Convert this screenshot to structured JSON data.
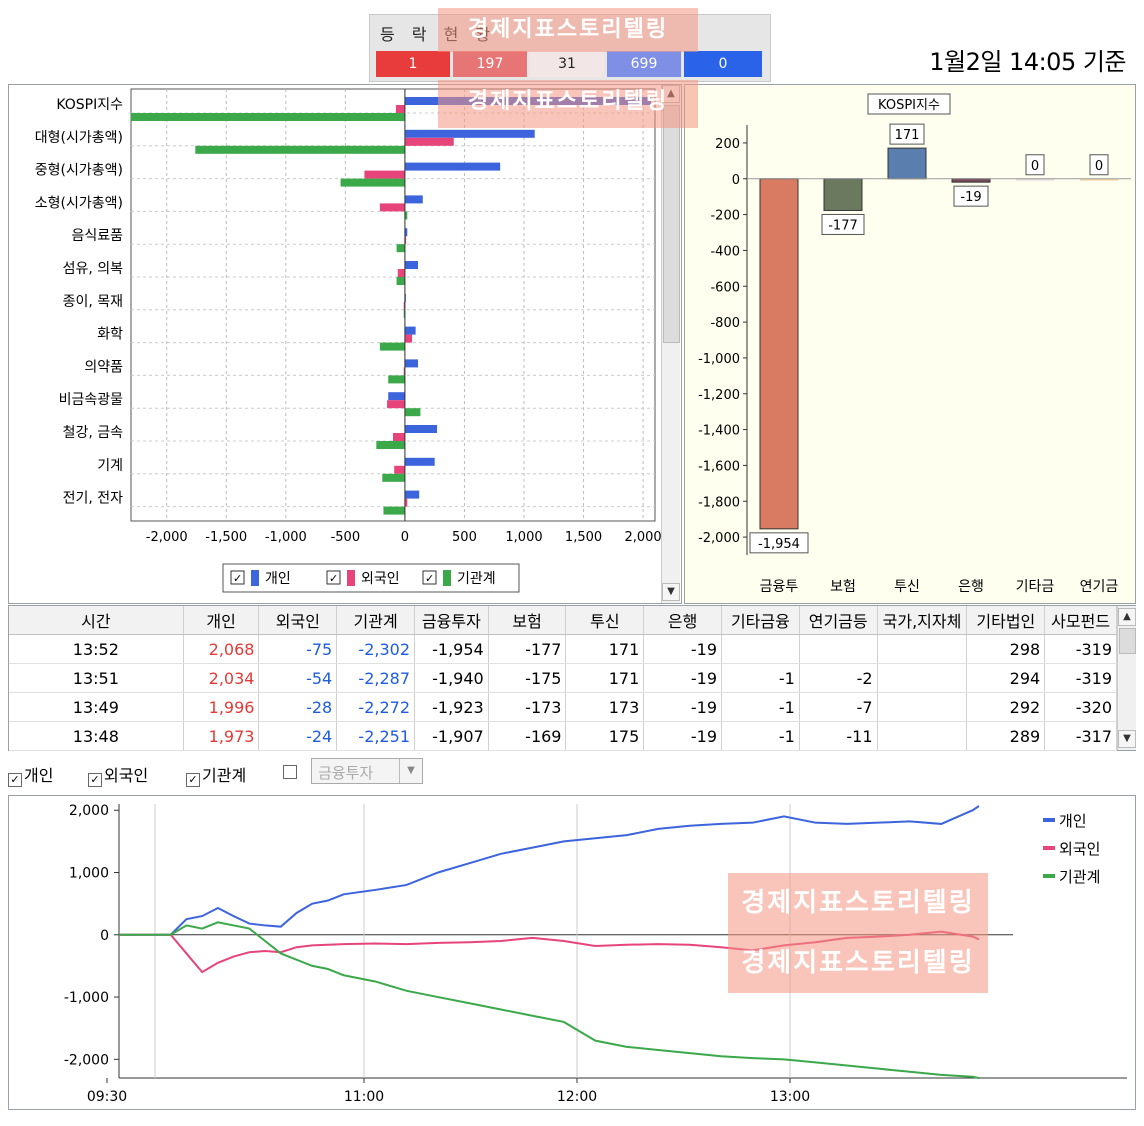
{
  "header": {
    "adv_title": "등 락 현 황",
    "adv_cells": [
      {
        "value": "1",
        "color": "#e83c3c"
      },
      {
        "value": "197",
        "color": "#e87575"
      },
      {
        "value": "31",
        "color": "#f3e6e6"
      },
      {
        "value": "699",
        "color": "#7f8fe6"
      },
      {
        "value": "0",
        "color": "#2a62e8"
      }
    ],
    "as_of": "1월2일 14:05 기준"
  },
  "watermark": "경제지표스토리텔링",
  "colors": {
    "individual": "#3c64dc",
    "foreign": "#e6447a",
    "institution": "#3ba84a"
  },
  "sector_chart": {
    "type": "bar",
    "categories": [
      "KOSPI지수",
      "대형(시가총액)",
      "중형(시가총액)",
      "소형(시가총액)",
      "음식료품",
      "섬유, 의복",
      "종이, 목재",
      "화학",
      "의약품",
      "비금속광물",
      "철강, 금속",
      "기계",
      "전기, 전자"
    ],
    "x_ticks": [
      "-2,000",
      "-1,500",
      "-1,000",
      "-500",
      "0",
      "500",
      "1,000",
      "1,500",
      "2,000"
    ],
    "xlim": [
      -2300,
      2100
    ],
    "series": [
      {
        "name": "개인",
        "values": [
          2068,
          1090,
          800,
          150,
          20,
          110,
          5,
          90,
          110,
          -140,
          270,
          250,
          120
        ]
      },
      {
        "name": "외국인",
        "values": [
          -75,
          410,
          -340,
          -210,
          10,
          -60,
          -10,
          60,
          -10,
          -150,
          -100,
          -90,
          20
        ]
      },
      {
        "name": "기관계",
        "values": [
          -2302,
          -1760,
          -540,
          20,
          -70,
          -70,
          -10,
          -210,
          -140,
          130,
          -240,
          -190,
          -180
        ]
      }
    ],
    "legend": [
      {
        "label": "개인",
        "checked": true
      },
      {
        "label": "외국인",
        "checked": true
      },
      {
        "label": "기관계",
        "checked": true
      }
    ]
  },
  "inst_chart": {
    "type": "bar",
    "title": "KOSPI지수",
    "categories": [
      "금융투",
      "보험",
      "투신",
      "은행",
      "기타금",
      "연기금"
    ],
    "values": [
      -1954,
      -177,
      171,
      -19,
      0,
      0
    ],
    "value_labels": [
      "-1,954",
      "-177",
      "171",
      "-19",
      "0",
      "0"
    ],
    "bar_colors": [
      "#d97b62",
      "#6b7a5e",
      "#5a7fae",
      "#7a4a5a",
      "#e8e0e0",
      "#f5d9a8"
    ],
    "y_ticks": [
      "200",
      "0",
      "-200",
      "-400",
      "-600",
      "-800",
      "-1,000",
      "-1,200",
      "-1,400",
      "-1,600",
      "-1,800",
      "-2,000"
    ],
    "ylim": [
      -2100,
      300
    ]
  },
  "table": {
    "headers": [
      "시간",
      "개인",
      "외국인",
      "기관계",
      "금융투자",
      "보험",
      "투신",
      "은행",
      "기타금융",
      "연기금등",
      "국가,지자체",
      "기타법인",
      "사모펀드"
    ],
    "rows": [
      [
        "13:52",
        "2,068",
        "-75",
        "-2,302",
        "-1,954",
        "-177",
        "171",
        "-19",
        "",
        "",
        "",
        "298",
        "-319"
      ],
      [
        "13:51",
        "2,034",
        "-54",
        "-2,287",
        "-1,940",
        "-175",
        "171",
        "-19",
        "-1",
        "-2",
        "",
        "294",
        "-319"
      ],
      [
        "13:49",
        "1,996",
        "-28",
        "-2,272",
        "-1,923",
        "-173",
        "173",
        "-19",
        "-1",
        "-7",
        "",
        "292",
        "-320"
      ],
      [
        "13:48",
        "1,973",
        "-24",
        "-2,251",
        "-1,907",
        "-169",
        "175",
        "-19",
        "-1",
        "-11",
        "",
        "289",
        "-317"
      ]
    ]
  },
  "controls": {
    "individual": "개인",
    "foreign": "외국인",
    "institution": "기관계",
    "combo": "금융투자"
  },
  "line_chart": {
    "type": "line",
    "x_ticks": [
      "09:30",
      "11:00",
      "12:00",
      "13:00"
    ],
    "y_ticks": [
      "2,000",
      "1,000",
      "0",
      "-1,000",
      "-2,000"
    ],
    "ylim": [
      -2300,
      2100
    ],
    "x_minutes": [
      0,
      5,
      10,
      15,
      20,
      25,
      30,
      35,
      40,
      45,
      50,
      55,
      60,
      70,
      80,
      90,
      100,
      110,
      120,
      130,
      140,
      150,
      160,
      170,
      180,
      190,
      200,
      210,
      220,
      230,
      240,
      250,
      260,
      262
    ],
    "series": [
      {
        "name": "개인",
        "values": [
          0,
          0,
          250,
          300,
          430,
          300,
          180,
          150,
          130,
          350,
          500,
          550,
          650,
          720,
          800,
          1000,
          1150,
          1300,
          1400,
          1500,
          1550,
          1600,
          1700,
          1750,
          1780,
          1800,
          1900,
          1800,
          1780,
          1800,
          1820,
          1780,
          2000,
          2068
        ]
      },
      {
        "name": "외국인",
        "values": [
          0,
          0,
          -300,
          -600,
          -450,
          -350,
          -280,
          -260,
          -280,
          -200,
          -170,
          -160,
          -150,
          -140,
          -150,
          -130,
          -120,
          -100,
          -50,
          -100,
          -180,
          -160,
          -150,
          -160,
          -200,
          -250,
          -170,
          -120,
          -50,
          -30,
          0,
          50,
          -30,
          -75
        ]
      },
      {
        "name": "기관계",
        "values": [
          0,
          0,
          150,
          100,
          200,
          150,
          100,
          -100,
          -300,
          -400,
          -500,
          -550,
          -650,
          -750,
          -900,
          -1000,
          -1100,
          -1200,
          -1300,
          -1400,
          -1700,
          -1800,
          -1850,
          -1900,
          -1950,
          -1980,
          -2000,
          -2050,
          -2100,
          -2150,
          -2200,
          -2250,
          -2280,
          -2302
        ]
      }
    ]
  }
}
